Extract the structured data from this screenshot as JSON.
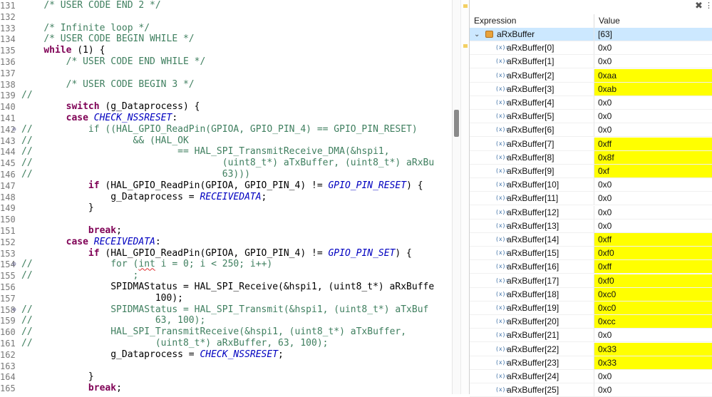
{
  "editor": {
    "lines": [
      {
        "num": "131",
        "fold": "",
        "segs": [
          {
            "t": "    "
          },
          {
            "t": "/* USER CODE END 2 */",
            "c": "cm"
          }
        ]
      },
      {
        "num": "132",
        "fold": "",
        "segs": []
      },
      {
        "num": "133",
        "fold": "",
        "segs": [
          {
            "t": "    "
          },
          {
            "t": "/* Infinite loop */",
            "c": "cm"
          }
        ]
      },
      {
        "num": "134",
        "fold": "",
        "segs": [
          {
            "t": "    "
          },
          {
            "t": "/* USER CODE BEGIN WHILE */",
            "c": "cm"
          }
        ]
      },
      {
        "num": "135",
        "fold": "",
        "segs": [
          {
            "t": "    "
          },
          {
            "t": "while",
            "c": "kw"
          },
          {
            "t": " (1) {"
          }
        ]
      },
      {
        "num": "136",
        "fold": "",
        "segs": [
          {
            "t": "        "
          },
          {
            "t": "/* USER CODE END WHILE */",
            "c": "cm"
          }
        ]
      },
      {
        "num": "137",
        "fold": "",
        "segs": []
      },
      {
        "num": "138",
        "fold": "",
        "segs": [
          {
            "t": "        "
          },
          {
            "t": "/* USER CODE BEGIN 3 */",
            "c": "cm"
          }
        ]
      },
      {
        "num": "139",
        "fold": "",
        "segs": [
          {
            "t": "//",
            "c": "cm"
          }
        ]
      },
      {
        "num": "140",
        "fold": "",
        "segs": [
          {
            "t": "        "
          },
          {
            "t": "switch",
            "c": "kw"
          },
          {
            "t": " (g_Dataprocess) {"
          }
        ]
      },
      {
        "num": "141",
        "fold": "",
        "segs": [
          {
            "t": "        "
          },
          {
            "t": "case",
            "c": "kw"
          },
          {
            "t": " "
          },
          {
            "t": "CHECK_NSSRESET",
            "c": "en"
          },
          {
            "t": ":"
          }
        ]
      },
      {
        "num": "142",
        "fold": "⊖",
        "segs": [
          {
            "t": "//",
            "c": "cm"
          },
          {
            "t": "          if ((HAL_GPIO_ReadPin(GPIOA, GPIO_PIN_4) == GPIO_PIN_RESET)",
            "c": "cm"
          }
        ]
      },
      {
        "num": "143",
        "fold": "",
        "segs": [
          {
            "t": "//",
            "c": "cm"
          },
          {
            "t": "                  && (HAL_OK",
            "c": "cm"
          }
        ]
      },
      {
        "num": "144",
        "fold": "",
        "segs": [
          {
            "t": "//",
            "c": "cm"
          },
          {
            "t": "                          == HAL_SPI_TransmitReceive_DMA(&hspi1,",
            "c": "cm"
          }
        ]
      },
      {
        "num": "145",
        "fold": "",
        "segs": [
          {
            "t": "//",
            "c": "cm"
          },
          {
            "t": "                                  (uint8_t*) aTxBuffer, (uint8_t*) aRxBu",
            "c": "cm"
          }
        ]
      },
      {
        "num": "146",
        "fold": "",
        "segs": [
          {
            "t": "//",
            "c": "cm"
          },
          {
            "t": "                                  63)))",
            "c": "cm"
          }
        ]
      },
      {
        "num": "147",
        "fold": "",
        "segs": [
          {
            "t": "            "
          },
          {
            "t": "if",
            "c": "kw"
          },
          {
            "t": " (HAL_GPIO_ReadPin(GPIOA, GPIO_PIN_4) != "
          },
          {
            "t": "GPIO_PIN_RESET",
            "c": "en"
          },
          {
            "t": ") {"
          }
        ]
      },
      {
        "num": "148",
        "fold": "",
        "segs": [
          {
            "t": "                g_Dataprocess = "
          },
          {
            "t": "RECEIVEDATA",
            "c": "en"
          },
          {
            "t": ";"
          }
        ]
      },
      {
        "num": "149",
        "fold": "",
        "segs": [
          {
            "t": "            }"
          }
        ]
      },
      {
        "num": "150",
        "fold": "",
        "segs": []
      },
      {
        "num": "151",
        "fold": "",
        "segs": [
          {
            "t": "            "
          },
          {
            "t": "break",
            "c": "kw"
          },
          {
            "t": ";"
          }
        ]
      },
      {
        "num": "152",
        "fold": "",
        "segs": [
          {
            "t": "        "
          },
          {
            "t": "case",
            "c": "kw"
          },
          {
            "t": " "
          },
          {
            "t": "RECEIVEDATA",
            "c": "en"
          },
          {
            "t": ":"
          }
        ]
      },
      {
        "num": "153",
        "fold": "",
        "segs": [
          {
            "t": "            "
          },
          {
            "t": "if",
            "c": "kw"
          },
          {
            "t": " (HAL_GPIO_ReadPin(GPIOA, GPIO_PIN_4) != "
          },
          {
            "t": "GPIO_PIN_SET",
            "c": "en"
          },
          {
            "t": ") {"
          }
        ]
      },
      {
        "num": "154",
        "fold": "⊖",
        "segs": [
          {
            "t": "//",
            "c": "cm"
          },
          {
            "t": "              for (",
            "c": "cm"
          },
          {
            "t": "int",
            "c": "cm sq"
          },
          {
            "t": " i = 0; i < 250; i++)",
            "c": "cm"
          }
        ]
      },
      {
        "num": "155",
        "fold": "",
        "segs": [
          {
            "t": "//",
            "c": "cm"
          },
          {
            "t": "                  ;",
            "c": "cm"
          }
        ]
      },
      {
        "num": "156",
        "fold": "",
        "segs": [
          {
            "t": "                SPIDMAStatus = HAL_SPI_Receive(&hspi1, (uint8_t*) aRxBuffe"
          }
        ]
      },
      {
        "num": "157",
        "fold": "",
        "segs": [
          {
            "t": "                        100);"
          }
        ]
      },
      {
        "num": "158",
        "fold": "⊖",
        "segs": [
          {
            "t": "//",
            "c": "cm"
          },
          {
            "t": "              SPIDMAStatus = HAL_SPI_Transmit(&hspi1, (uint8_t*) aTxBuf",
            "c": "cm"
          }
        ]
      },
      {
        "num": "159",
        "fold": "",
        "segs": [
          {
            "t": "//",
            "c": "cm"
          },
          {
            "t": "                      63, 100);",
            "c": "cm"
          }
        ]
      },
      {
        "num": "160",
        "fold": "",
        "segs": [
          {
            "t": "//",
            "c": "cm"
          },
          {
            "t": "              HAL_SPI_TransmitReceive(&hspi1, (uint8_t*) aTxBuffer,",
            "c": "cm"
          }
        ]
      },
      {
        "num": "161",
        "fold": "",
        "segs": [
          {
            "t": "//",
            "c": "cm"
          },
          {
            "t": "                      (uint8_t*) aRxBuffer, 63, 100);",
            "c": "cm"
          }
        ]
      },
      {
        "num": "162",
        "fold": "",
        "segs": [
          {
            "t": "                g_Dataprocess = "
          },
          {
            "t": "CHECK_NSSRESET",
            "c": "en"
          },
          {
            "t": ";"
          }
        ]
      },
      {
        "num": "163",
        "fold": "",
        "segs": []
      },
      {
        "num": "164",
        "fold": "",
        "segs": [
          {
            "t": "            }"
          }
        ]
      },
      {
        "num": "165",
        "fold": "",
        "segs": [
          {
            "t": "            "
          },
          {
            "t": "break",
            "c": "kw"
          },
          {
            "t": ";"
          }
        ]
      }
    ]
  },
  "expressions": {
    "toolbar": {
      "collapse_icon": "collapse-all-icon",
      "collapse_glyph": "✖",
      "menu_icon": "view-menu-icon",
      "menu_glyph": "⋮"
    },
    "columns": {
      "expression": "Expression",
      "value": "Value"
    },
    "highlight_color": "#ffff00",
    "root": {
      "name": "aRxBuffer",
      "value": "[63]",
      "expanded": true,
      "twisty_glyph": "⌄"
    },
    "var_icon_glyph": "(x)=",
    "items": [
      {
        "name": "aRxBuffer[0]",
        "value": "0x0",
        "changed": false
      },
      {
        "name": "aRxBuffer[1]",
        "value": "0x0",
        "changed": false
      },
      {
        "name": "aRxBuffer[2]",
        "value": "0xaa",
        "changed": true
      },
      {
        "name": "aRxBuffer[3]",
        "value": "0xab",
        "changed": true
      },
      {
        "name": "aRxBuffer[4]",
        "value": "0x0",
        "changed": false
      },
      {
        "name": "aRxBuffer[5]",
        "value": "0x0",
        "changed": false
      },
      {
        "name": "aRxBuffer[6]",
        "value": "0x0",
        "changed": false
      },
      {
        "name": "aRxBuffer[7]",
        "value": "0xff",
        "changed": true
      },
      {
        "name": "aRxBuffer[8]",
        "value": "0x8f",
        "changed": true
      },
      {
        "name": "aRxBuffer[9]",
        "value": "0xf",
        "changed": true
      },
      {
        "name": "aRxBuffer[10]",
        "value": "0x0",
        "changed": false
      },
      {
        "name": "aRxBuffer[11]",
        "value": "0x0",
        "changed": false
      },
      {
        "name": "aRxBuffer[12]",
        "value": "0x0",
        "changed": false
      },
      {
        "name": "aRxBuffer[13]",
        "value": "0x0",
        "changed": false
      },
      {
        "name": "aRxBuffer[14]",
        "value": "0xff",
        "changed": true
      },
      {
        "name": "aRxBuffer[15]",
        "value": "0xf0",
        "changed": true
      },
      {
        "name": "aRxBuffer[16]",
        "value": "0xff",
        "changed": true
      },
      {
        "name": "aRxBuffer[17]",
        "value": "0xf0",
        "changed": true
      },
      {
        "name": "aRxBuffer[18]",
        "value": "0xc0",
        "changed": true
      },
      {
        "name": "aRxBuffer[19]",
        "value": "0xc0",
        "changed": true
      },
      {
        "name": "aRxBuffer[20]",
        "value": "0xcc",
        "changed": true
      },
      {
        "name": "aRxBuffer[21]",
        "value": "0x0",
        "changed": false
      },
      {
        "name": "aRxBuffer[22]",
        "value": "0x33",
        "changed": true
      },
      {
        "name": "aRxBuffer[23]",
        "value": "0x33",
        "changed": true
      },
      {
        "name": "aRxBuffer[24]",
        "value": "0x0",
        "changed": false
      },
      {
        "name": "aRxBuffer[25]",
        "value": "0x0",
        "changed": false
      }
    ]
  }
}
